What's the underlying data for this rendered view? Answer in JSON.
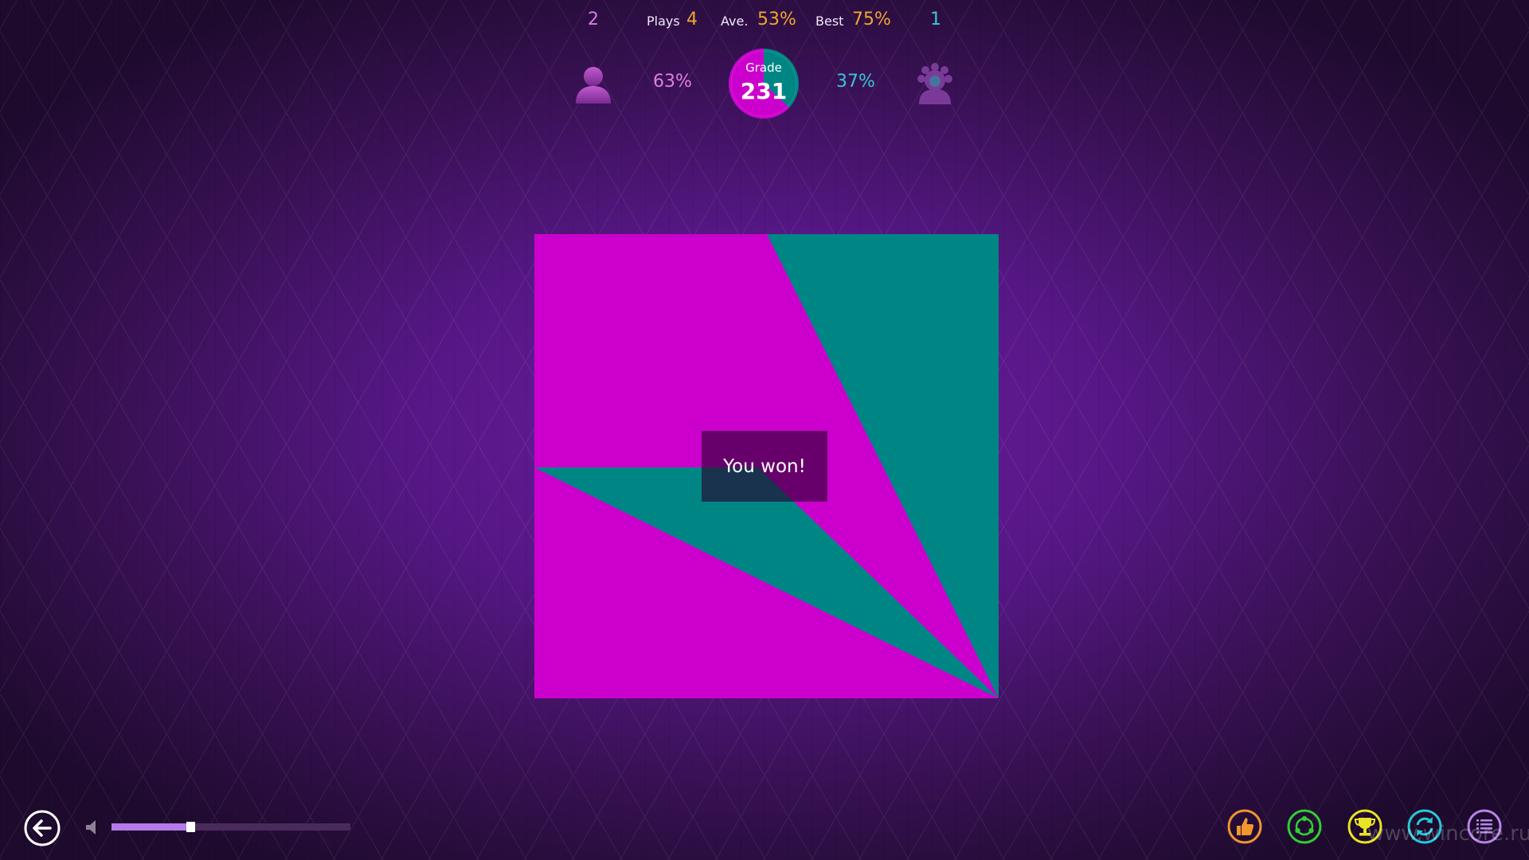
{
  "scoreboard": {
    "player_score": "2",
    "cpu_score": "1",
    "plays_label": "Plays",
    "plays_value": "4",
    "ave_label": "Ave.",
    "ave_value": "53%",
    "best_label": "Best",
    "best_value": "75%",
    "player_percent": "63%",
    "cpu_percent": "37%",
    "player_fraction": 0.63,
    "grade_label": "Grade",
    "grade_value": "231"
  },
  "board": {
    "message": "You won!",
    "colors": {
      "player": "#cc00cc",
      "cpu": "#008585"
    }
  },
  "volume": {
    "level": 0.33
  },
  "toolbar": {
    "icons": [
      {
        "name": "thumbs-up-icon",
        "color": "#f0962d"
      },
      {
        "name": "share-icon",
        "color": "#32cd32"
      },
      {
        "name": "trophy-icon",
        "color": "#e8e324"
      },
      {
        "name": "refresh-icon",
        "color": "#27c9d8"
      },
      {
        "name": "list-icon",
        "color": "#b784e8"
      }
    ]
  },
  "watermark": "www.wincore.ru",
  "colors": {
    "accent_orange": "#f0a62d",
    "player_pink": "#d67ee4",
    "cpu_teal": "#3cc7d6"
  }
}
